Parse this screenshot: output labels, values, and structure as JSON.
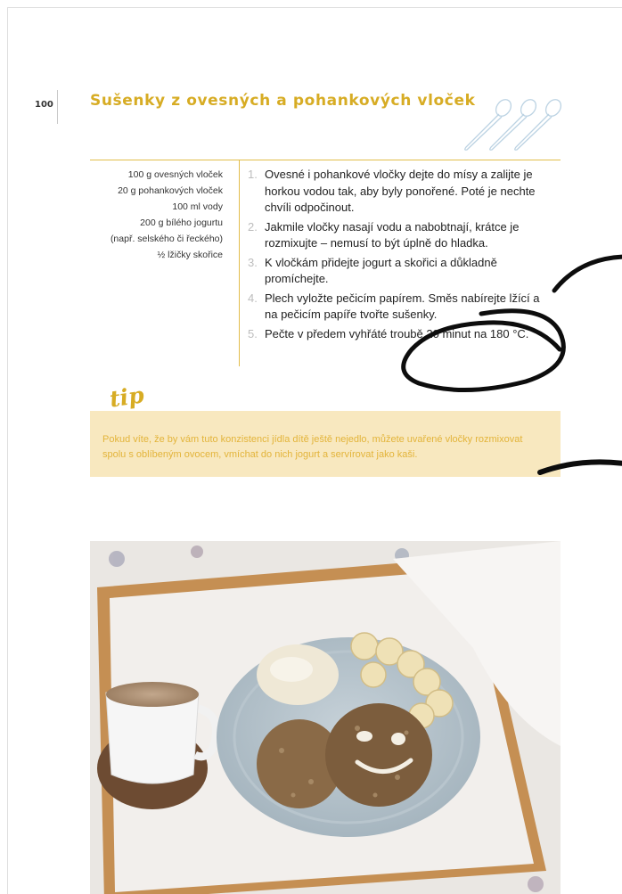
{
  "page_number": "100",
  "title": "Sušenky z ovesných a pohankových vloček",
  "ingredients": [
    "100 g ovesných vloček",
    "20 g pohankových vloček",
    "100 ml vody",
    "200 g bílého jogurtu",
    "(např. selského či řeckého)",
    "½ lžičky skořice"
  ],
  "steps": [
    {
      "num": "1.",
      "text": "Ovesné i pohankové vločky dejte do mísy a zalijte je horkou vodou tak, aby byly ponořené. Poté je nechte chvíli odpočinout."
    },
    {
      "num": "2.",
      "text": "Jakmile vločky nasají vodu a nabobtnají, krátce je rozmixujte – nemusí to být úplně do hladka."
    },
    {
      "num": "3.",
      "text": "K vločkám přidejte jogurt a skořici a důkladně promíchejte."
    },
    {
      "num": "4.",
      "text": "Plech vyložte pečicím papírem. Směs nabírejte lžící a na pečicím papíře tvořte sušenky."
    },
    {
      "num": "5.",
      "text": "Pečte v předem vyhřáté troubě 20 minut na 180 °C."
    }
  ],
  "tip": {
    "label": "tip",
    "text": "Pokud víte, že by vám tuto konzistenci jídla dítě ještě nejedlo, můžete uvařené vločky rozmixovat spolu s oblíbeným ovocem, vmíchat do nich jogurt a servírovat jako kaši."
  },
  "colors": {
    "accent": "#d7ac24",
    "tip_background": "#f8e8bf",
    "tip_text": "#e3b43a",
    "step_number": "#bdbdbd"
  },
  "icons": {
    "decoration": "spoons-icon"
  }
}
